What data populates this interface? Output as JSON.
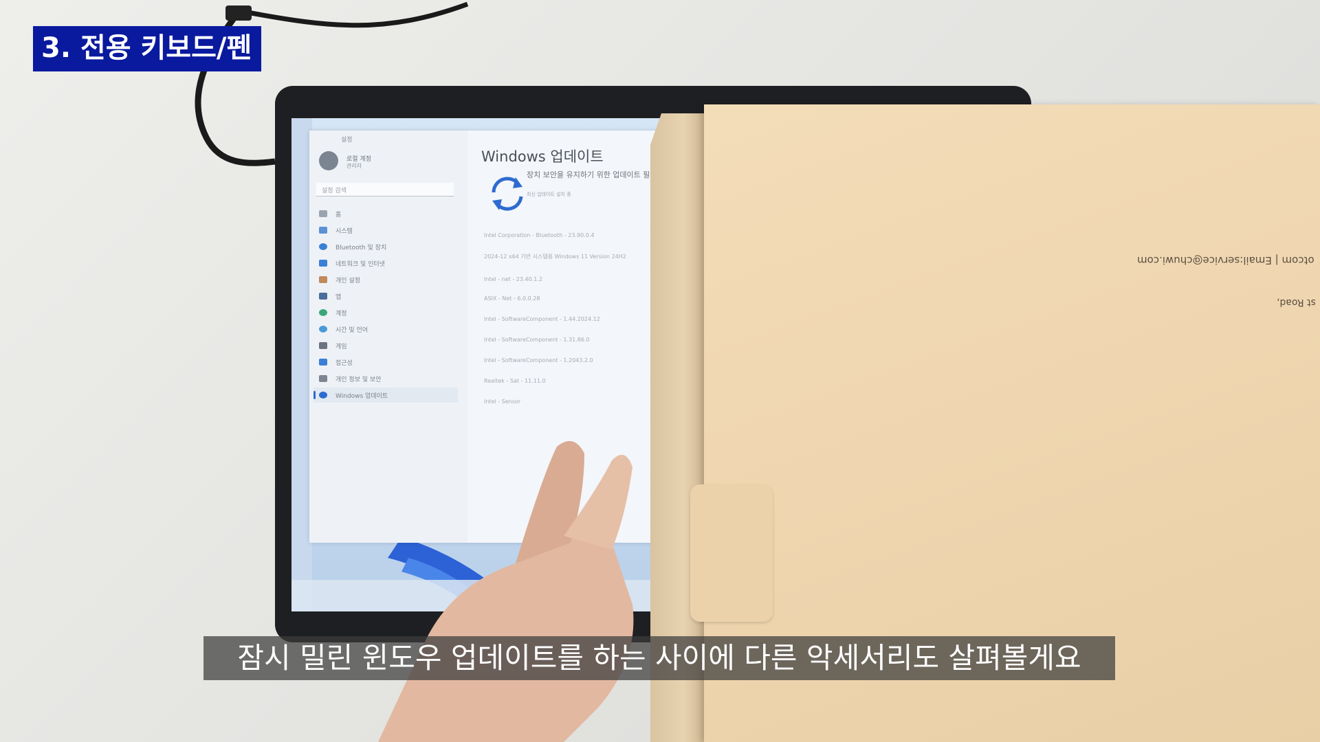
{
  "overlay": {
    "chapter_title": "3. 전용 키보드/펜",
    "subtitle": "잠시 밀린 윈도우 업데이트를 하는 사이에 다른 악세서리도 살펴볼게요"
  },
  "settings_window": {
    "page_title": "Windows 업데이트",
    "nav_items": [
      {
        "label": "홈",
        "icon": "home-icon"
      },
      {
        "label": "시스템",
        "icon": "monitor-icon"
      },
      {
        "label": "Bluetooth 및 장치",
        "icon": "bluetooth-icon"
      },
      {
        "label": "네트워크 및 인터넷",
        "icon": "wifi-icon"
      },
      {
        "label": "개인 설정",
        "icon": "pen-icon"
      },
      {
        "label": "앱",
        "icon": "apps-icon"
      },
      {
        "label": "계정",
        "icon": "person-icon"
      },
      {
        "label": "시간 및 언어",
        "icon": "globe-icon"
      },
      {
        "label": "게임",
        "icon": "gamepad-icon"
      },
      {
        "label": "접근성",
        "icon": "accessibility-icon"
      },
      {
        "label": "개인 정보 및 보안",
        "icon": "shield-icon"
      },
      {
        "label": "Windows 업데이트",
        "icon": "update-icon",
        "selected": true
      }
    ],
    "update_rows": [
      "Intel Corporation - Bluetooth - 23.90.0.4",
      "2024-12 x64 기반 시스템용 Windows 11 Version 24H2",
      "Intel - net - 23.40.1.2",
      "ASIX - Net - 6.0.0.28",
      "Intel - SoftwareComponent - 1.44.2024.12",
      "Intel - SoftwareComponent - 1.31.86.0",
      "Intel - SoftwareComponent - 1.2043.2.0",
      "Realtek - Sat - 11.11.0",
      "Intel - Sensor"
    ]
  },
  "envelope": {
    "printed_text": "otcom | Email:service@chuwi.com",
    "printed_text_2": "st Road,"
  },
  "colors": {
    "badge_bg": "#0a1a9e",
    "envelope": "#efd6b0",
    "accent": "#2d6bd0"
  }
}
